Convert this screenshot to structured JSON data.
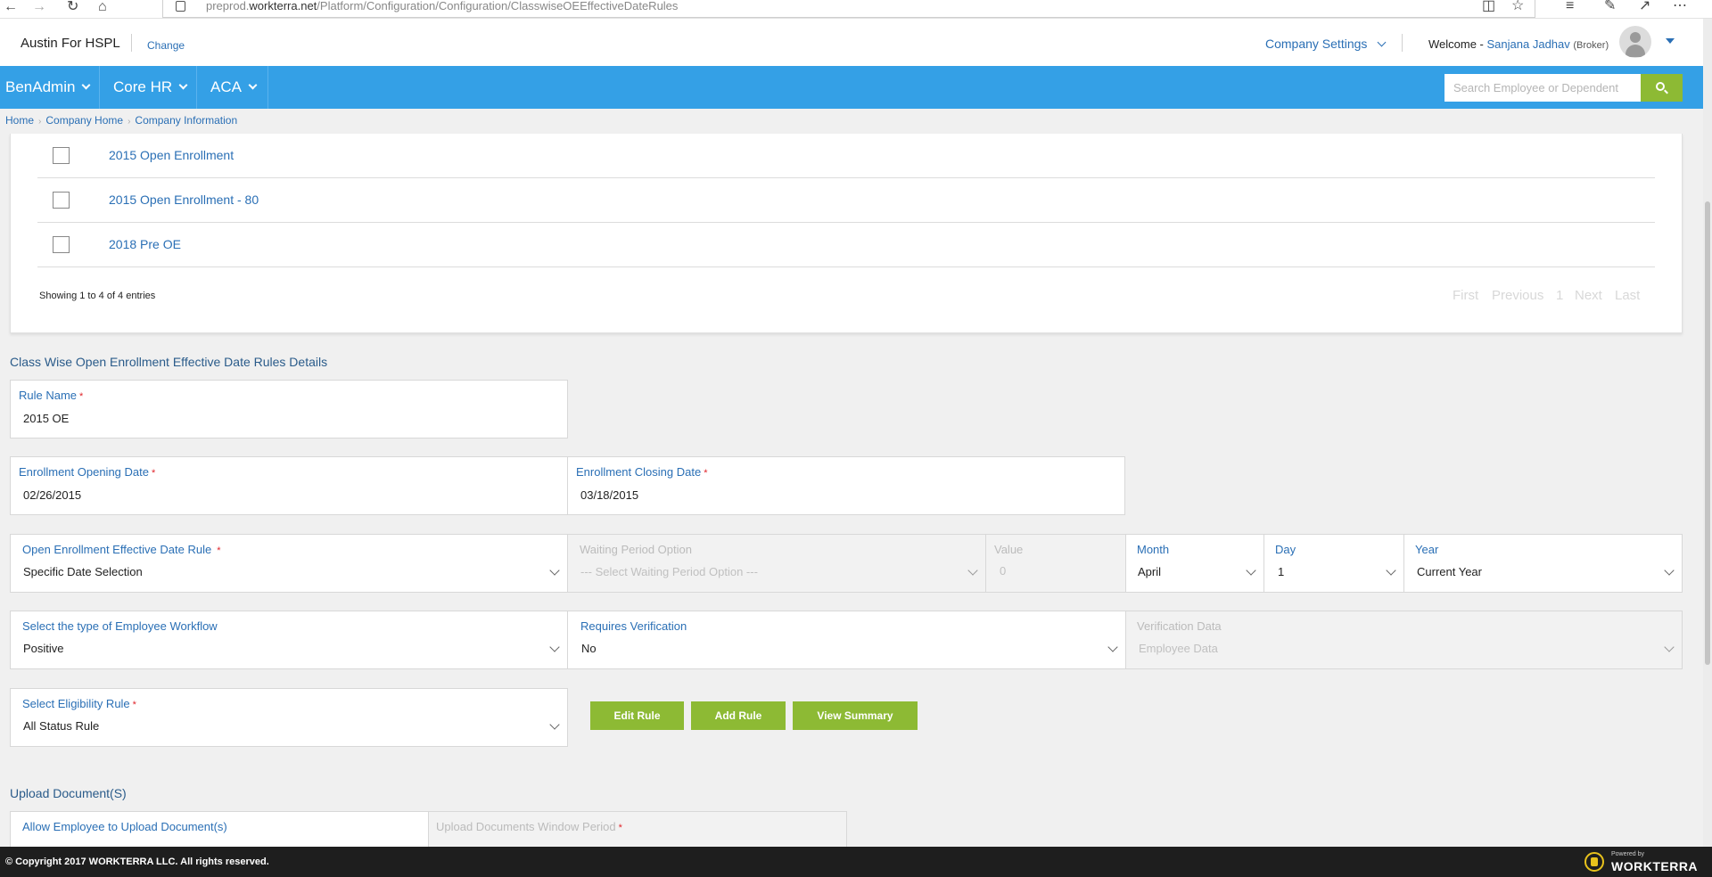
{
  "browser": {
    "url_prefix": "preprod.",
    "url_domain": "workterra.net",
    "url_path": "/Platform/Configuration/Configuration/ClasswiseOEEffectiveDateRules"
  },
  "header": {
    "company_name": "Austin For HSPL",
    "change_label": "Change",
    "company_settings_label": "Company Settings",
    "welcome_label": "Welcome -",
    "user_name": "Sanjana Jadhav",
    "user_role": "(Broker)"
  },
  "nav": {
    "items": [
      {
        "label": "BenAdmin"
      },
      {
        "label": "Core HR"
      },
      {
        "label": "ACA"
      }
    ],
    "search_placeholder": "Search Employee or Dependent"
  },
  "breadcrumb": [
    "Home",
    "Company Home",
    "Company Information"
  ],
  "enrollment_list": {
    "rows": [
      {
        "label": "2015 Open Enrollment",
        "checked": false
      },
      {
        "label": "2015 Open Enrollment - 80",
        "checked": false
      },
      {
        "label": "2018 Pre OE",
        "checked": false
      }
    ],
    "entries_text": "Showing 1 to 4 of 4 entries",
    "pager": {
      "first": "First",
      "previous": "Previous",
      "page": "1",
      "next": "Next",
      "last": "Last"
    }
  },
  "details": {
    "section_title": "Class Wise Open Enrollment Effective Date Rules Details",
    "rule_name": {
      "label": "Rule Name",
      "value": "2015 OE"
    },
    "opening_date": {
      "label": "Enrollment Opening Date",
      "value": "02/26/2015"
    },
    "closing_date": {
      "label": "Enrollment Closing Date",
      "value": "03/18/2015"
    },
    "effective_rule": {
      "label": "Open Enrollment Effective Date Rule",
      "value": "Specific Date Selection"
    },
    "waiting_period": {
      "label": "Waiting Period Option",
      "value": "--- Select Waiting Period Option ---"
    },
    "value_field": {
      "label": "Value",
      "value": "0"
    },
    "month": {
      "label": "Month",
      "value": "April"
    },
    "day": {
      "label": "Day",
      "value": "1"
    },
    "year": {
      "label": "Year",
      "value": "Current Year"
    },
    "workflow": {
      "label": "Select the type of Employee Workflow",
      "value": "Positive"
    },
    "requires_verification": {
      "label": "Requires Verification",
      "value": "No"
    },
    "verification_data": {
      "label": "Verification Data",
      "value": "Employee Data"
    },
    "eligibility_rule": {
      "label": "Select Eligibility Rule",
      "value": "All Status Rule"
    },
    "buttons": {
      "edit": "Edit Rule",
      "add": "Add Rule",
      "summary": "View Summary"
    }
  },
  "upload": {
    "section_title": "Upload Document(S)",
    "allow_upload": {
      "label": "Allow Employee to Upload Document(s)"
    },
    "window_period": {
      "label": "Upload Documents Window Period"
    }
  },
  "footer": {
    "copyright": "© Copyright 2017 WORKTERRA LLC. All rights reserved.",
    "powered_by": "Powered by",
    "brand": "WORKTERRA"
  },
  "colors": {
    "nav_blue": "#34a0e6",
    "accent_green": "#8dba34",
    "link_blue": "#2a6fb5",
    "required_red": "#e0252b",
    "footer_dark": "#1e1e1e"
  }
}
